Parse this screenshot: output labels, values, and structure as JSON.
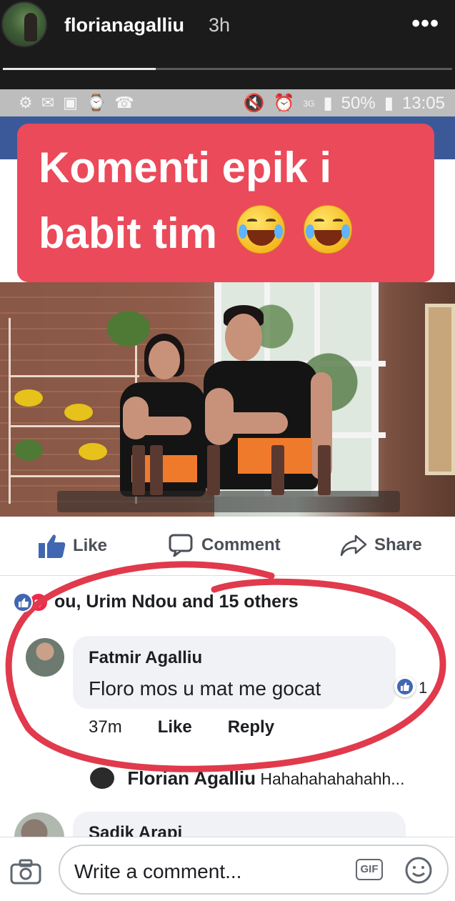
{
  "story": {
    "username": "floriana galliu",
    "username_display": "florianagalliu",
    "time": "3h",
    "more": "•••",
    "progress": 0.34
  },
  "status_bar": {
    "battery": "50%",
    "time": "13:05",
    "network": "3G"
  },
  "sticker": {
    "line1": "Komenti epik i",
    "line2": "babit tim"
  },
  "actions": {
    "like": "Like",
    "comment": "Comment",
    "share": "Share"
  },
  "reactions_text": "ou, Urim Ndou and 15 others",
  "comment": {
    "author": "Fatmir Agalliu",
    "text": "Floro mos u mat me gocat",
    "time": "37m",
    "like": "Like",
    "reply": "Reply",
    "like_count": "1"
  },
  "reply_preview": {
    "author": "Florian Agalliu",
    "text": "Hahahahahahahh..."
  },
  "next_comment": {
    "author": "Sadik Arapi"
  },
  "composer": {
    "placeholder": "Write a comment...",
    "gif": "GIF"
  },
  "colors": {
    "facebook_blue": "#3b5998",
    "sticker_red": "#ea4a5a",
    "annotation_red": "#e03a4c",
    "like_blue": "#4267b2"
  }
}
